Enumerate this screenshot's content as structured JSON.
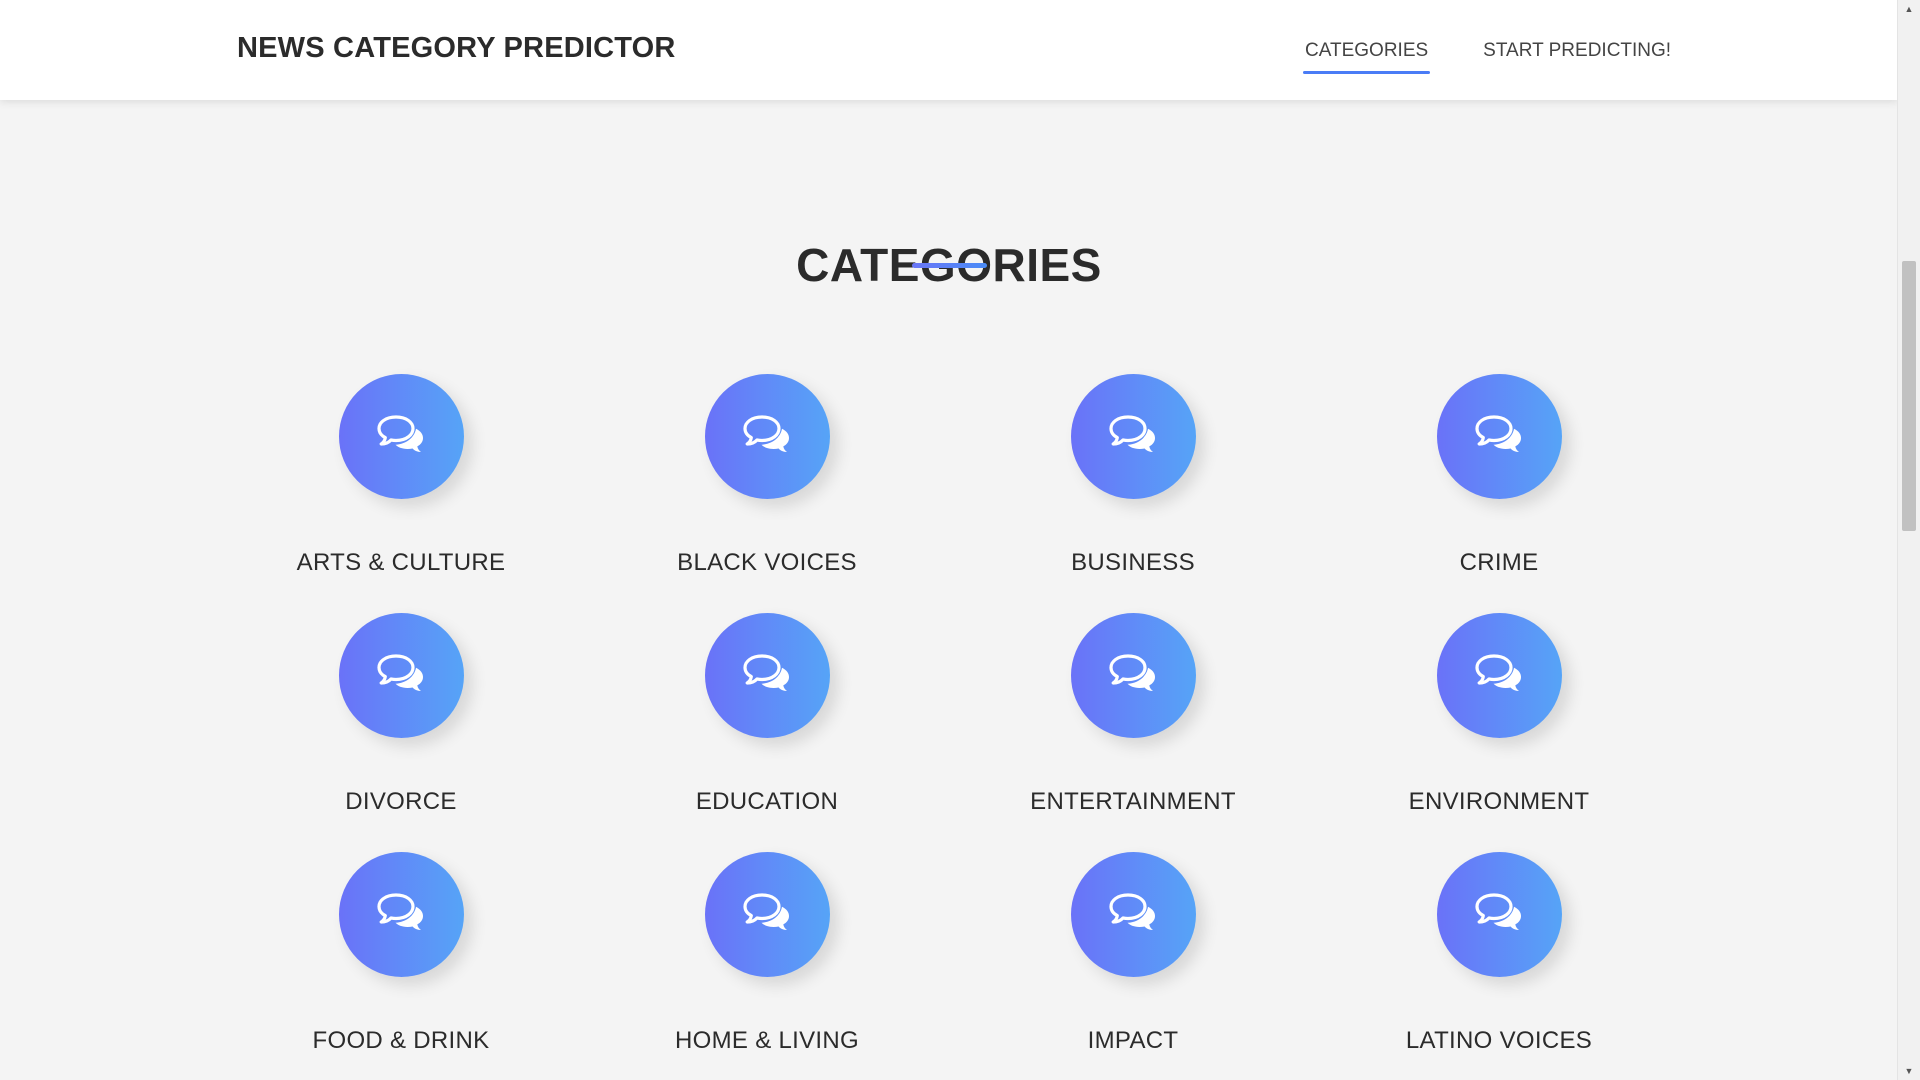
{
  "header": {
    "brand": "NEWS CATEGORY PREDICTOR",
    "nav": [
      {
        "label": "CATEGORIES",
        "active": true
      },
      {
        "label": "START PREDICTING!",
        "active": false
      }
    ]
  },
  "section": {
    "title": "CATEGORIES"
  },
  "categories": [
    {
      "label": "ARTS & CULTURE",
      "icon": "chat-bubbles-icon"
    },
    {
      "label": "BLACK VOICES",
      "icon": "chat-bubbles-icon"
    },
    {
      "label": "BUSINESS",
      "icon": "chat-bubbles-icon"
    },
    {
      "label": "CRIME",
      "icon": "chat-bubbles-icon"
    },
    {
      "label": "DIVORCE",
      "icon": "chat-bubbles-icon"
    },
    {
      "label": "EDUCATION",
      "icon": "chat-bubbles-icon"
    },
    {
      "label": "ENTERTAINMENT",
      "icon": "chat-bubbles-icon"
    },
    {
      "label": "ENVIRONMENT",
      "icon": "chat-bubbles-icon"
    },
    {
      "label": "FOOD & DRINK",
      "icon": "chat-bubbles-icon"
    },
    {
      "label": "HOME & LIVING",
      "icon": "chat-bubbles-icon"
    },
    {
      "label": "IMPACT",
      "icon": "chat-bubbles-icon"
    },
    {
      "label": "LATINO VOICES",
      "icon": "chat-bubbles-icon"
    }
  ],
  "colors": {
    "accent_start": "#6a72f8",
    "accent_end": "#56a4f7",
    "nav_underline": "#4a7cf6",
    "background": "#f4f4f4"
  }
}
